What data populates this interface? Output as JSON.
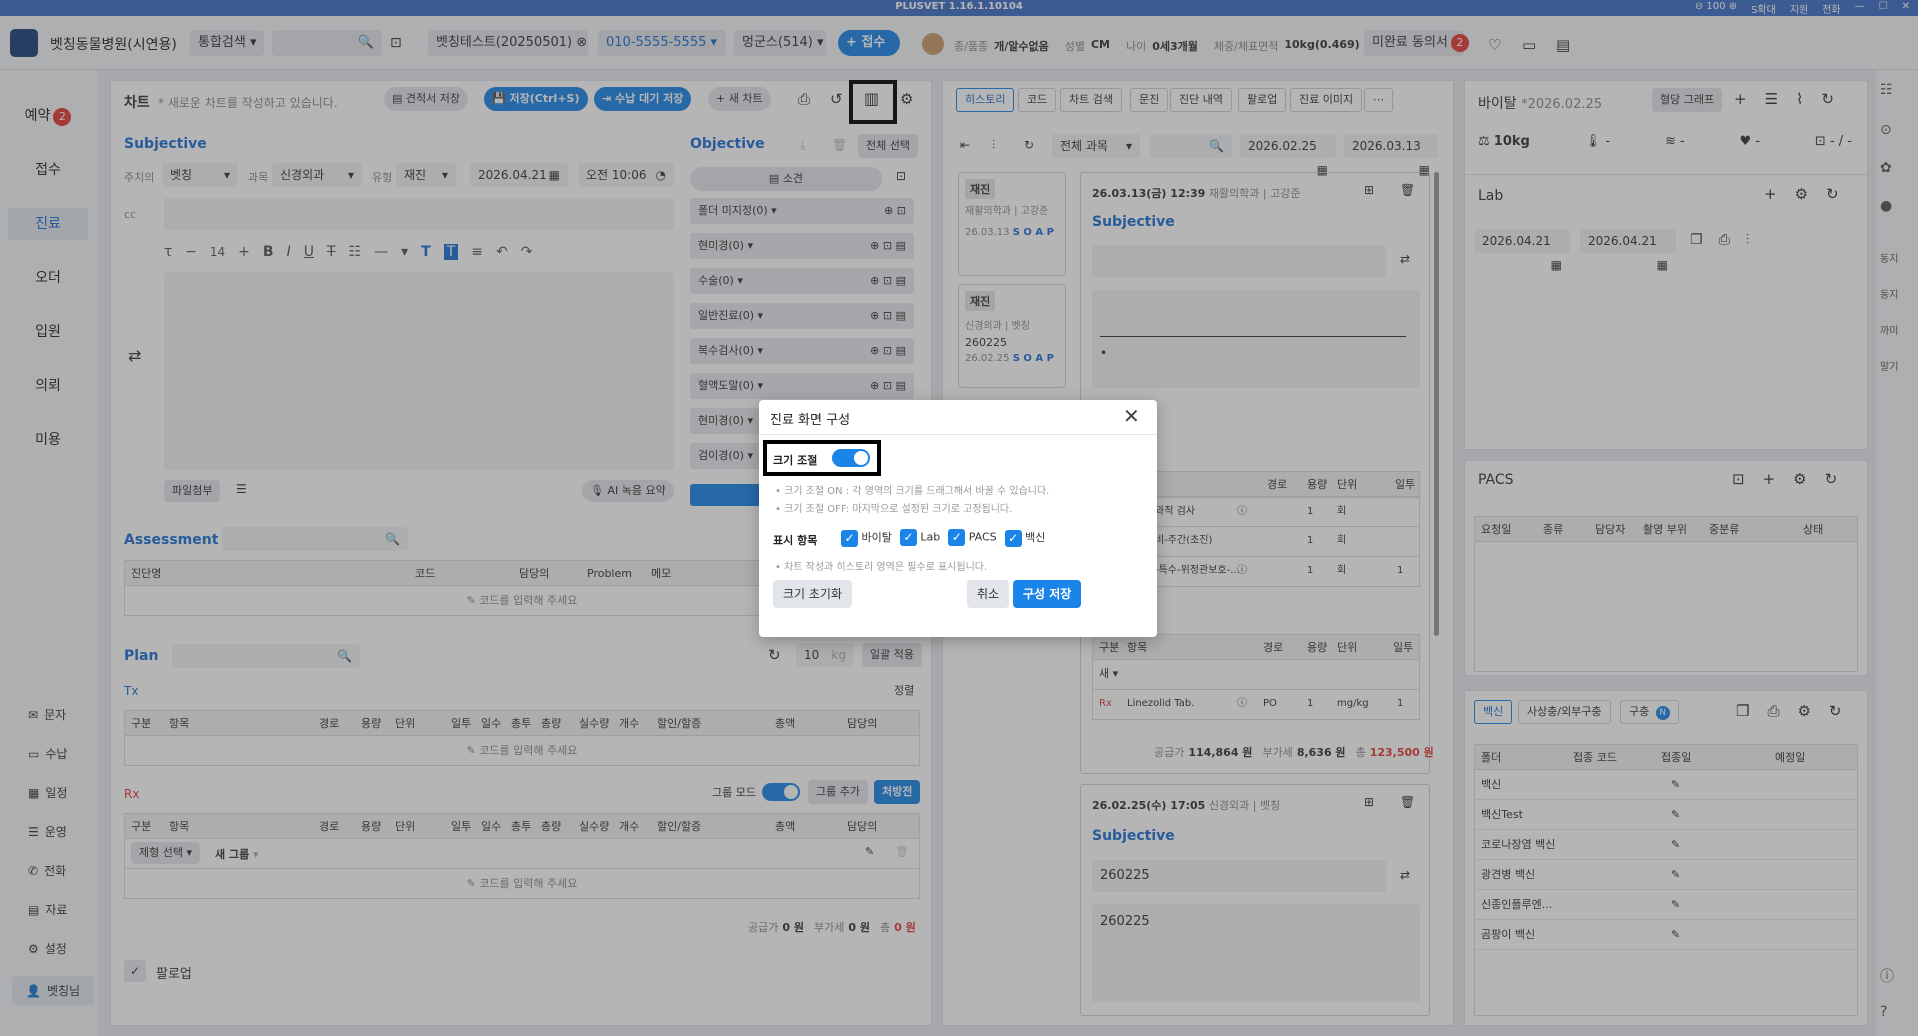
{
  "titlebar": {
    "title": "PLUSVET 1.16.1.10104",
    "zoom": "100",
    "fit": "S확대",
    "support": "지원",
    "phone": "전화"
  },
  "topbar": {
    "hospital": "벳칭동물병원(시연용)",
    "search_scope": "통합검색",
    "owner": "벳칭테스트(20250501)",
    "phone": "010-5555-5555",
    "pet": "멍군스(514)",
    "receive_btn": "+ 접수",
    "species_lbl": "종/품종",
    "species": "개/알수없음",
    "sex_lbl": "성별",
    "sex": "CM",
    "age_lbl": "나이",
    "age": "0세3개월",
    "weight_lbl": "체중/체표면적",
    "weight": "10kg(0.469)",
    "consent": "미완료 동의서",
    "consent_count": "2"
  },
  "sidebar": {
    "items": [
      {
        "label": "예약",
        "badge": "2"
      },
      {
        "label": "접수"
      },
      {
        "label": "진료"
      },
      {
        "label": "오더"
      },
      {
        "label": "입원"
      },
      {
        "label": "의뢰"
      },
      {
        "label": "미용"
      }
    ],
    "small": [
      "문자",
      "수납",
      "일정",
      "운영",
      "전화",
      "자료",
      "설정",
      "벳칭님"
    ]
  },
  "chart": {
    "title": "차트",
    "subtitle": "* 새로운 차트를 작성하고 있습니다.",
    "btn_estimate": "견적서 저장",
    "btn_save": "저장(Ctrl+S)",
    "btn_pending": "수납 대기 저장",
    "btn_new": "+ 새 차트"
  },
  "subjective": {
    "title": "Subjective",
    "doctor_lbl": "주치의",
    "doctor": "벳칭",
    "dept_lbl": "과목",
    "dept": "신경외과",
    "type_lbl": "유형",
    "type": "재진",
    "date": "2026.04.21",
    "time": "오전 10:06",
    "cc": "cc",
    "font_size": "14",
    "attach": "파일첨부",
    "ai": "AI 녹음 요약"
  },
  "objective": {
    "title": "Objective",
    "select_all": "전체 선택",
    "findings": "소견",
    "rows": [
      "폴더 미지정(0)",
      "현미경(0)",
      "수술(0)",
      "일반진료(0)",
      "복수검사(0)",
      "혈액도말(0)",
      "현미경(0)",
      "검이경(0)"
    ]
  },
  "assessment": {
    "title": "Assessment",
    "cols": [
      "진단명",
      "코드",
      "담당의",
      "Problem",
      "메모"
    ],
    "placeholder": "코드를 입력해 주세요"
  },
  "plan": {
    "title": "Plan",
    "weight": "10",
    "weight_unit": "kg",
    "apply": "일괄 적용",
    "tx": "Tx",
    "sort": "정렬",
    "cols": [
      "구분",
      "항목",
      "경로",
      "용량",
      "단위",
      "일투",
      "일수",
      "총투",
      "총량",
      "실수량",
      "개수",
      "할인/할증",
      "총액",
      "담당의"
    ],
    "placeholder": "코드를 입력해 주세요",
    "rx": "Rx",
    "group_mode": "그룹 모드",
    "add_group": "그룹 추가",
    "prescription": "처방전",
    "type_select": "제형 선택",
    "new_group": "새 그룹",
    "supply_lbl": "공급가",
    "supply": "0 원",
    "vat_lbl": "부가세",
    "vat": "0 원",
    "total_lbl": "총",
    "total": "0 원",
    "followup": "팔로업"
  },
  "history": {
    "tabs": [
      "히스토리",
      "코드",
      "차트 검색",
      "문진",
      "진단 내역",
      "팔로업",
      "진료 이미지"
    ],
    "scope": "전체 과목",
    "date_from": "2026.02.25",
    "date_to": "2026.03.13",
    "cards": [
      {
        "type": "재진",
        "dept": "재활의학과 | 고강준",
        "date": "26.03.13",
        "letters": "S O A P"
      },
      {
        "type": "재진",
        "dept": "신경외과 | 벳칭",
        "note": "260225",
        "date": "26.02.25",
        "letters": "S O A P"
      }
    ],
    "entry1": {
      "header": "26.03.13(금) 12:39",
      "dept": "재활의학과 | 고강준",
      "subj": "Subjective",
      "cols": [
        "경로",
        "용량",
        "단위",
        "일투"
      ],
      "rows": [
        {
          "item": "과적 검사",
          "q": "1",
          "u": "회",
          "d": ""
        },
        {
          "item": "비-주간(초진)",
          "q": "1",
          "u": "회",
          "d": ""
        },
        {
          "item": "-특수-위정관보호-...",
          "q": "1",
          "u": "회",
          "d": "1"
        }
      ],
      "rx_cols": [
        "구분",
        "항목",
        "경로",
        "용량",
        "단위",
        "일투"
      ],
      "rx_new": "새",
      "rx_item": {
        "type": "Rx",
        "name": "Linezolid Tab.",
        "route": "PO",
        "dose": "1",
        "unit": "mg/kg",
        "days": "1"
      },
      "supply": "114,864 원",
      "vat": "8,636 원",
      "total": "123,500 원",
      "supply_lbl": "공급가",
      "vat_lbl": "부가세",
      "total_lbl": "총"
    },
    "entry2": {
      "header": "26.02.25(수) 17:05",
      "dept": "신경외과 | 벳칭",
      "subj": "Subjective",
      "val1": "260225",
      "val2": "260225"
    }
  },
  "vital": {
    "title": "바이탈",
    "date": "*2026.02.25",
    "graph": "혈당 그래프",
    "weight": "10kg",
    "temp": "-",
    "resp": "-",
    "heart": "-",
    "bp": "- / -"
  },
  "lab": {
    "title": "Lab",
    "from": "2026.04.21",
    "to": "2026.04.21"
  },
  "pacs": {
    "title": "PACS",
    "cols": [
      "요청일",
      "종류",
      "담당자",
      "촬영 부위",
      "중분류",
      "상태"
    ]
  },
  "vaccine": {
    "tabs": [
      "백신",
      "사상충/외부구충",
      "구충"
    ],
    "cols": [
      "폴더",
      "접종 코드",
      "접종일",
      "예정일"
    ],
    "rows": [
      "백신",
      "백신Test",
      "코로나장염 백신",
      "광견병 백신",
      "신종인플루엔...",
      "곰팡이 백신"
    ]
  },
  "right_rail": [
    "동지",
    "동지",
    "까미",
    "말기"
  ],
  "modal": {
    "title": "진료 화면 구성",
    "resize_label": "크기 조절",
    "desc1": "• 크기 조절 ON : 각 영역의 크기를 드래그해서 바꿀 수 있습니다.",
    "desc2": "• 크기 조절 OFF: 마지막으로 설정된 크기로 고정됩니다.",
    "display_label": "표시 항목",
    "opts": [
      "바이탈",
      "Lab",
      "PACS",
      "백신"
    ],
    "note": "• 차트 작성과 히스토리 영역은 필수로 표시됩니다.",
    "reset": "크기 초기화",
    "cancel": "취소",
    "save": "구성 저장"
  }
}
